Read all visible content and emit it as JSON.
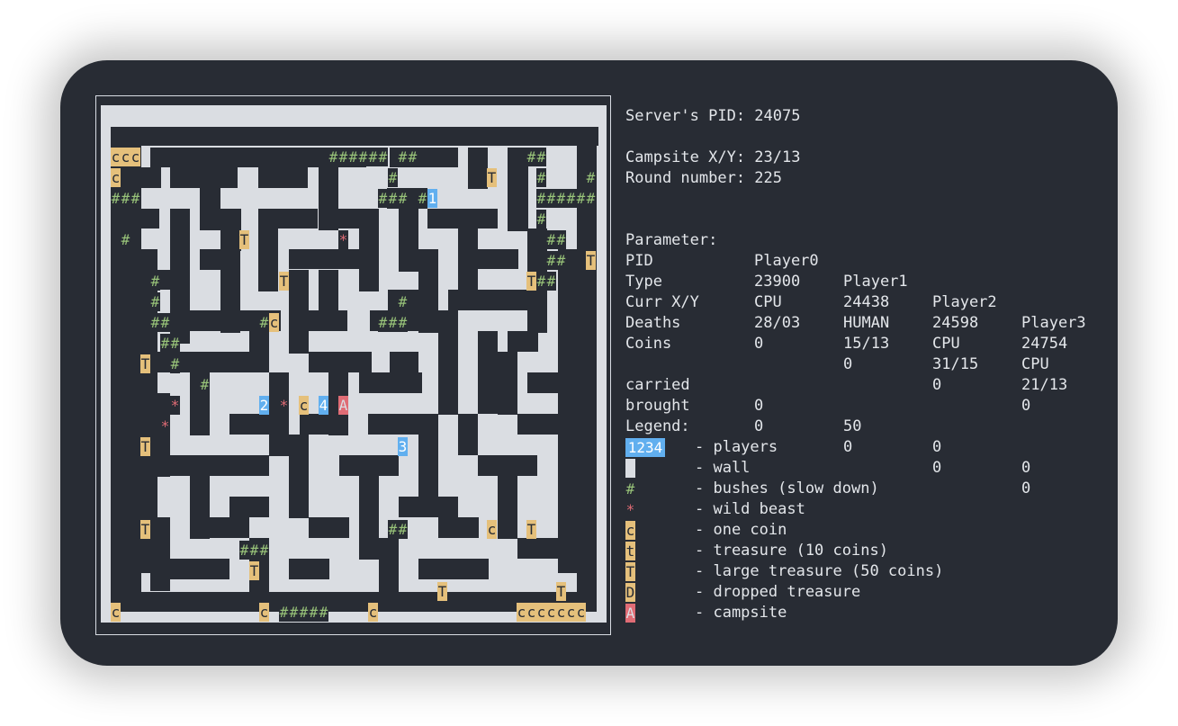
{
  "colors": {
    "background": "#282c34",
    "wall": "#dadde2",
    "text": "#e3e6ea",
    "bush": "#98c379",
    "beast": "#e06c75",
    "coin_bg": "#e5c07b",
    "player_bg": "#61afef",
    "campsite_bg": "#e06c75"
  },
  "maze": {
    "rows": [
      "                                                 ",
      "ccc                   ###### ##           ##     ",
      "c                           #         T    #    #",
      "###                        ### #1          ######",
      "                                           #     ",
      " #           T         *                    ##   ",
      "                                            ##  T",
      "    #            T                        T##   ",
      "    #                        #                   ",
      "    ##         #c          ###                   ",
      "     ##                                         ",
      "   T  #                                          ",
      "         #                                       ",
      "      *        2 * c 4 A                         ",
      "     *                                           ",
      "   T                         3                   ",
      "                                                 ",
      "                                                 ",
      "                                                 ",
      "   T                        ##        c   T     ",
      "             ###                                 ",
      "              T                                  ",
      "                                 T           T   ",
      "c              c #####    c              ccccccc  "
    ]
  },
  "info": {
    "server_pid_label": "Server's PID: 24075",
    "campsite_label": "Campsite X/Y: 23/13",
    "round_label": "Round number: 225",
    "table": {
      "headers": [
        "Parameter:",
        "Player0",
        "Player1",
        "Player2",
        "Player3"
      ],
      "rows": [
        [
          "PID",
          "23900",
          "24438",
          "24598",
          "24754"
        ],
        [
          "Type",
          "CPU",
          "HUMAN",
          "CPU",
          "CPU"
        ],
        [
          "Curr X/Y",
          "28/03",
          "15/13",
          "31/15",
          "21/13"
        ],
        [
          "Deaths",
          "0",
          "0",
          "0",
          "0"
        ]
      ]
    },
    "coins_title": "Coins",
    "coins": [
      [
        "carried",
        "0",
        "50",
        "0",
        "0"
      ],
      [
        "brought",
        "0",
        "0",
        "0",
        "0"
      ]
    ]
  },
  "legend": {
    "title": "Legend:",
    "items": [
      {
        "symbol": "1234",
        "desc": "- players",
        "kind": "player"
      },
      {
        "symbol": "",
        "desc": "- wall",
        "kind": "wall"
      },
      {
        "symbol": "#",
        "desc": "- bushes (slow down)",
        "kind": "bush"
      },
      {
        "symbol": "*",
        "desc": "- wild beast",
        "kind": "beast"
      },
      {
        "symbol": "c",
        "desc": "- one coin",
        "kind": "coin"
      },
      {
        "symbol": "t",
        "desc": "- treasure (10 coins)",
        "kind": "coin"
      },
      {
        "symbol": "T",
        "desc": "- large treasure (50 coins)",
        "kind": "coin"
      },
      {
        "symbol": "D",
        "desc": "- dropped treasure",
        "kind": "coin"
      },
      {
        "symbol": "A",
        "desc": "- campsite",
        "kind": "campsite"
      }
    ]
  }
}
